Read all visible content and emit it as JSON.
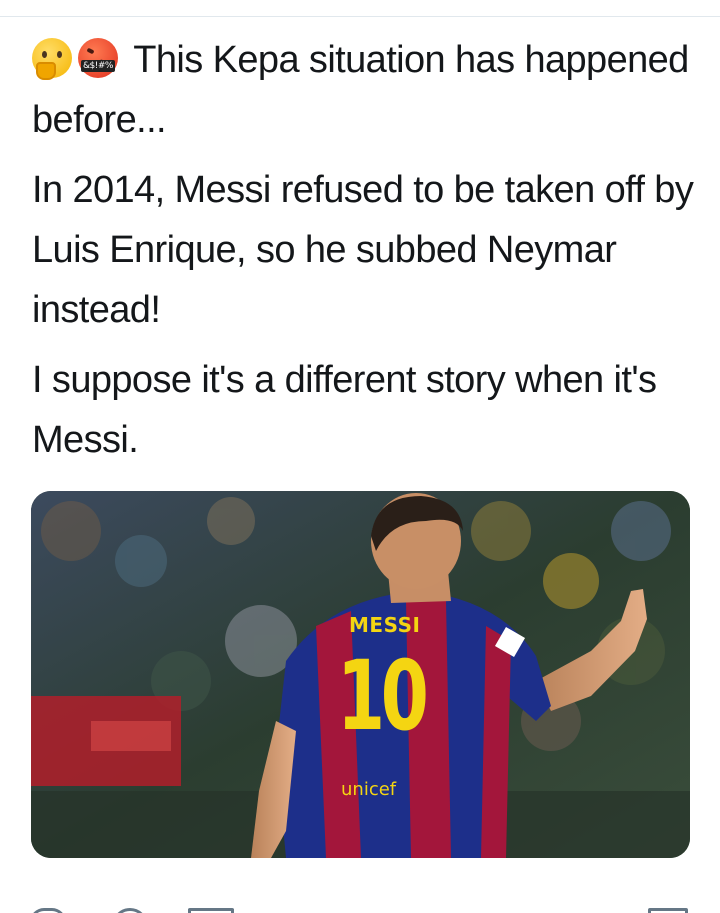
{
  "tweet": {
    "emojis": [
      "thinking-face",
      "face-with-symbols-on-mouth"
    ],
    "curse_symbols": "&$!#%",
    "line1": "This Kepa situation has happened before...",
    "paragraph2": "In 2014, Messi refused to be taken off by Luis Enrique, so he subbed Neymar instead!",
    "paragraph3": "I suppose it's a different story when it's Messi."
  },
  "media": {
    "jersey_name": "MESSI",
    "jersey_number": "10",
    "sponsor": "unicef",
    "colors": {
      "blue": "#1d2f8a",
      "garnet": "#a3163b",
      "gold": "#f4d512",
      "pitch_crowd": "#2f4a35"
    }
  },
  "actions": [
    "reply-icon",
    "retweet-icon",
    "like-icon",
    "share-icon"
  ]
}
